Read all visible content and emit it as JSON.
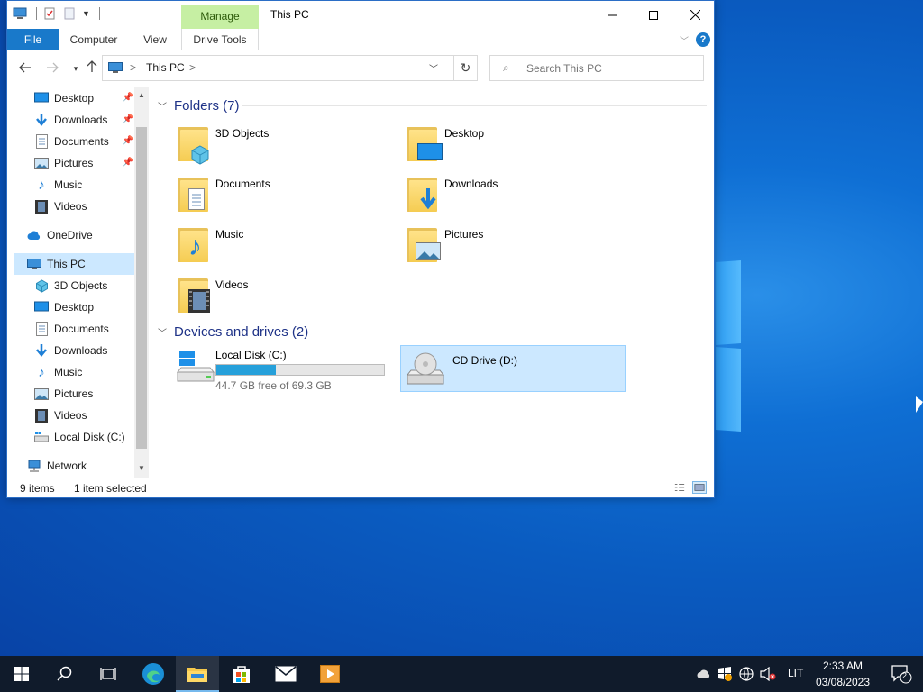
{
  "window": {
    "title": "This PC",
    "manage_tab": "Manage",
    "ribbon_tabs": [
      "File",
      "Computer",
      "View",
      "Drive Tools"
    ]
  },
  "address": {
    "crumb": "This PC",
    "separator": ">",
    "search_placeholder": "Search This PC"
  },
  "nav": {
    "quick_access": [
      {
        "label": "Desktop",
        "icon": "desktop-icon",
        "pinned": true
      },
      {
        "label": "Downloads",
        "icon": "downloads-icon",
        "pinned": true
      },
      {
        "label": "Documents",
        "icon": "documents-icon",
        "pinned": true
      },
      {
        "label": "Pictures",
        "icon": "pictures-icon",
        "pinned": true
      },
      {
        "label": "Music",
        "icon": "music-icon",
        "pinned": false
      },
      {
        "label": "Videos",
        "icon": "videos-icon",
        "pinned": false
      }
    ],
    "onedrive": "OneDrive",
    "this_pc": "This PC",
    "this_pc_children": [
      {
        "label": "3D Objects",
        "icon": "3d-objects-icon"
      },
      {
        "label": "Desktop",
        "icon": "desktop-icon"
      },
      {
        "label": "Documents",
        "icon": "documents-icon"
      },
      {
        "label": "Downloads",
        "icon": "downloads-icon"
      },
      {
        "label": "Music",
        "icon": "music-icon"
      },
      {
        "label": "Pictures",
        "icon": "pictures-icon"
      },
      {
        "label": "Videos",
        "icon": "videos-icon"
      },
      {
        "label": "Local Disk (C:)",
        "icon": "drive-icon"
      }
    ],
    "network": "Network"
  },
  "content": {
    "folders_header": "Folders (7)",
    "folders": [
      {
        "label": "3D Objects",
        "icon": "3d-objects-icon"
      },
      {
        "label": "Desktop",
        "icon": "desktop-icon"
      },
      {
        "label": "Documents",
        "icon": "documents-icon"
      },
      {
        "label": "Downloads",
        "icon": "downloads-icon"
      },
      {
        "label": "Music",
        "icon": "music-icon"
      },
      {
        "label": "Pictures",
        "icon": "pictures-icon"
      },
      {
        "label": "Videos",
        "icon": "videos-icon"
      }
    ],
    "drives_header": "Devices and drives (2)",
    "drives": [
      {
        "label": "Local Disk (C:)",
        "free_text": "44.7 GB free of 69.3 GB",
        "used_fraction": 0.355
      },
      {
        "label": "CD Drive (D:)",
        "selected": true
      }
    ]
  },
  "status": {
    "items": "9 items",
    "selected": "1 item selected"
  },
  "taskbar": {
    "time": "2:33 AM",
    "date": "03/08/2023",
    "language": "LIT",
    "notification_count": "2"
  },
  "colors": {
    "accent": "#1979ca",
    "selection": "#cce8ff",
    "manage_tab": "#c6efa3",
    "desktop": "#0a5bc0",
    "taskbar": "#101b2b"
  }
}
